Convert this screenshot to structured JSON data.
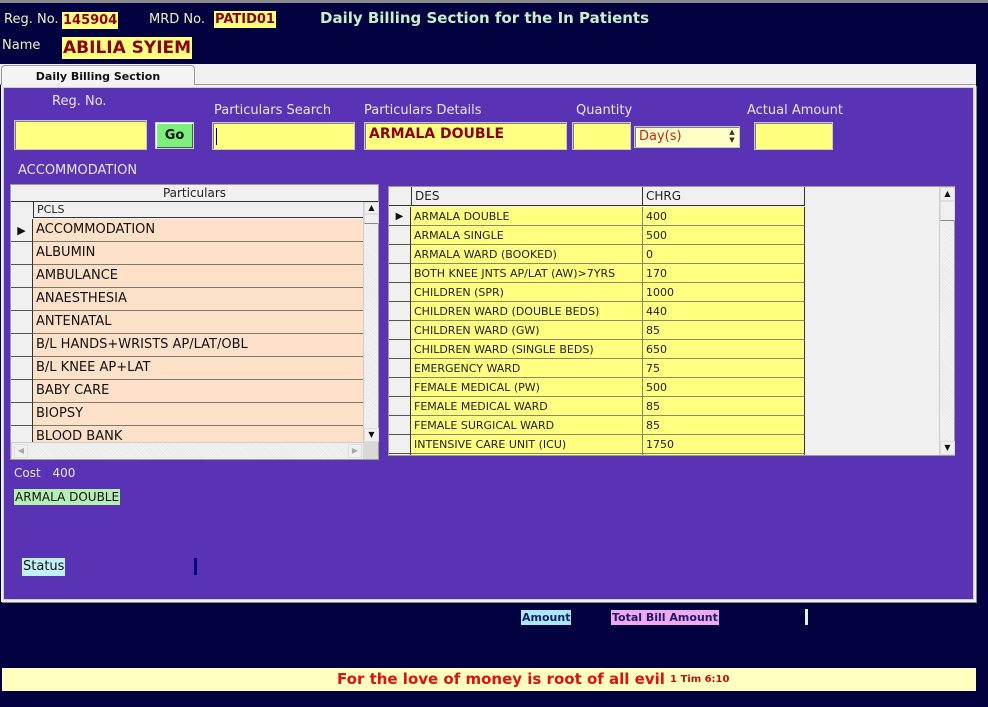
{
  "header": {
    "reg_no_label": "Reg. No.",
    "reg_no_value": "145904",
    "mrd_no_label": "MRD No.",
    "mrd_no_value": "PATID01",
    "name_label": "Name",
    "name_value": "ABILIA SYIEM",
    "title": "Daily Billing Section for the In Patients"
  },
  "tabs": [
    {
      "label": "Daily Billing Section",
      "active": true
    }
  ],
  "form": {
    "reg_no_label": "Reg. No.",
    "reg_no_value": "",
    "go_label": "Go",
    "particulars_search_label": "Particulars Search",
    "particulars_search_value": "",
    "particulars_details_label": "Particulars Details",
    "particulars_details_value": "ARMALA DOUBLE",
    "quantity_label": "Quantity",
    "quantity_value": "",
    "unit_selected": "Day(s)",
    "actual_amount_label": "Actual Amount",
    "actual_amount_value": "",
    "category_label": "ACCOMMODATION"
  },
  "particulars_grid": {
    "caption": "Particulars",
    "column": "PCLS",
    "current_row_marker": "▶",
    "rows": [
      "ACCOMMODATION",
      "ALBUMIN",
      "AMBULANCE",
      "ANAESTHESIA",
      "ANTENATAL",
      "B/L HANDS+WRISTS AP/LAT/OBL",
      "B/L KNEE AP+LAT",
      "BABY CARE",
      "BIOPSY",
      "BLOOD BANK"
    ]
  },
  "details_grid": {
    "columns": [
      "DES",
      "CHRG"
    ],
    "current_row_marker": "▶",
    "rows": [
      {
        "des": "ARMALA DOUBLE",
        "chrg": "400"
      },
      {
        "des": "ARMALA SINGLE",
        "chrg": "500"
      },
      {
        "des": "ARMALA WARD (BOOKED)",
        "chrg": "0"
      },
      {
        "des": "BOTH KNEE JNTS AP/LAT (AW)>7YRS",
        "chrg": "170"
      },
      {
        "des": "CHILDREN (SPR)",
        "chrg": "1000"
      },
      {
        "des": "CHILDREN WARD (DOUBLE BEDS)",
        "chrg": "440"
      },
      {
        "des": "CHILDREN WARD (GW)",
        "chrg": "85"
      },
      {
        "des": "CHILDREN WARD (SINGLE BEDS)",
        "chrg": "650"
      },
      {
        "des": "EMERGENCY WARD",
        "chrg": "75"
      },
      {
        "des": "FEMALE MEDICAL (PW)",
        "chrg": "500"
      },
      {
        "des": "FEMALE MEDICAL WARD",
        "chrg": "85"
      },
      {
        "des": "FEMALE SURGICAL WARD",
        "chrg": "85"
      },
      {
        "des": "INTENSIVE CARE UNIT (ICU)",
        "chrg": "1750"
      }
    ]
  },
  "summary": {
    "cost_label": "Cost",
    "cost_value": "400",
    "selected_description": "ARMALA DOUBLE",
    "status_label": "Status",
    "amount_label": "Amount",
    "total_bill_label": "Total Bill Amount"
  },
  "footer": {
    "quote": "For the love of money is root of all evil",
    "reference": "1 Tim 6:10"
  },
  "icons": {
    "scroll_up": "▲",
    "scroll_down": "▼",
    "scroll_left": "◀",
    "scroll_right": "▶",
    "spin_up": "▲",
    "spin_down": "▼"
  },
  "colors": {
    "background": "#020240",
    "panel": "#5a32b4",
    "field": "#ffff80",
    "go_button": "#7cf07c",
    "particulars_row": "#fde0c8",
    "quote": "#e01010"
  }
}
